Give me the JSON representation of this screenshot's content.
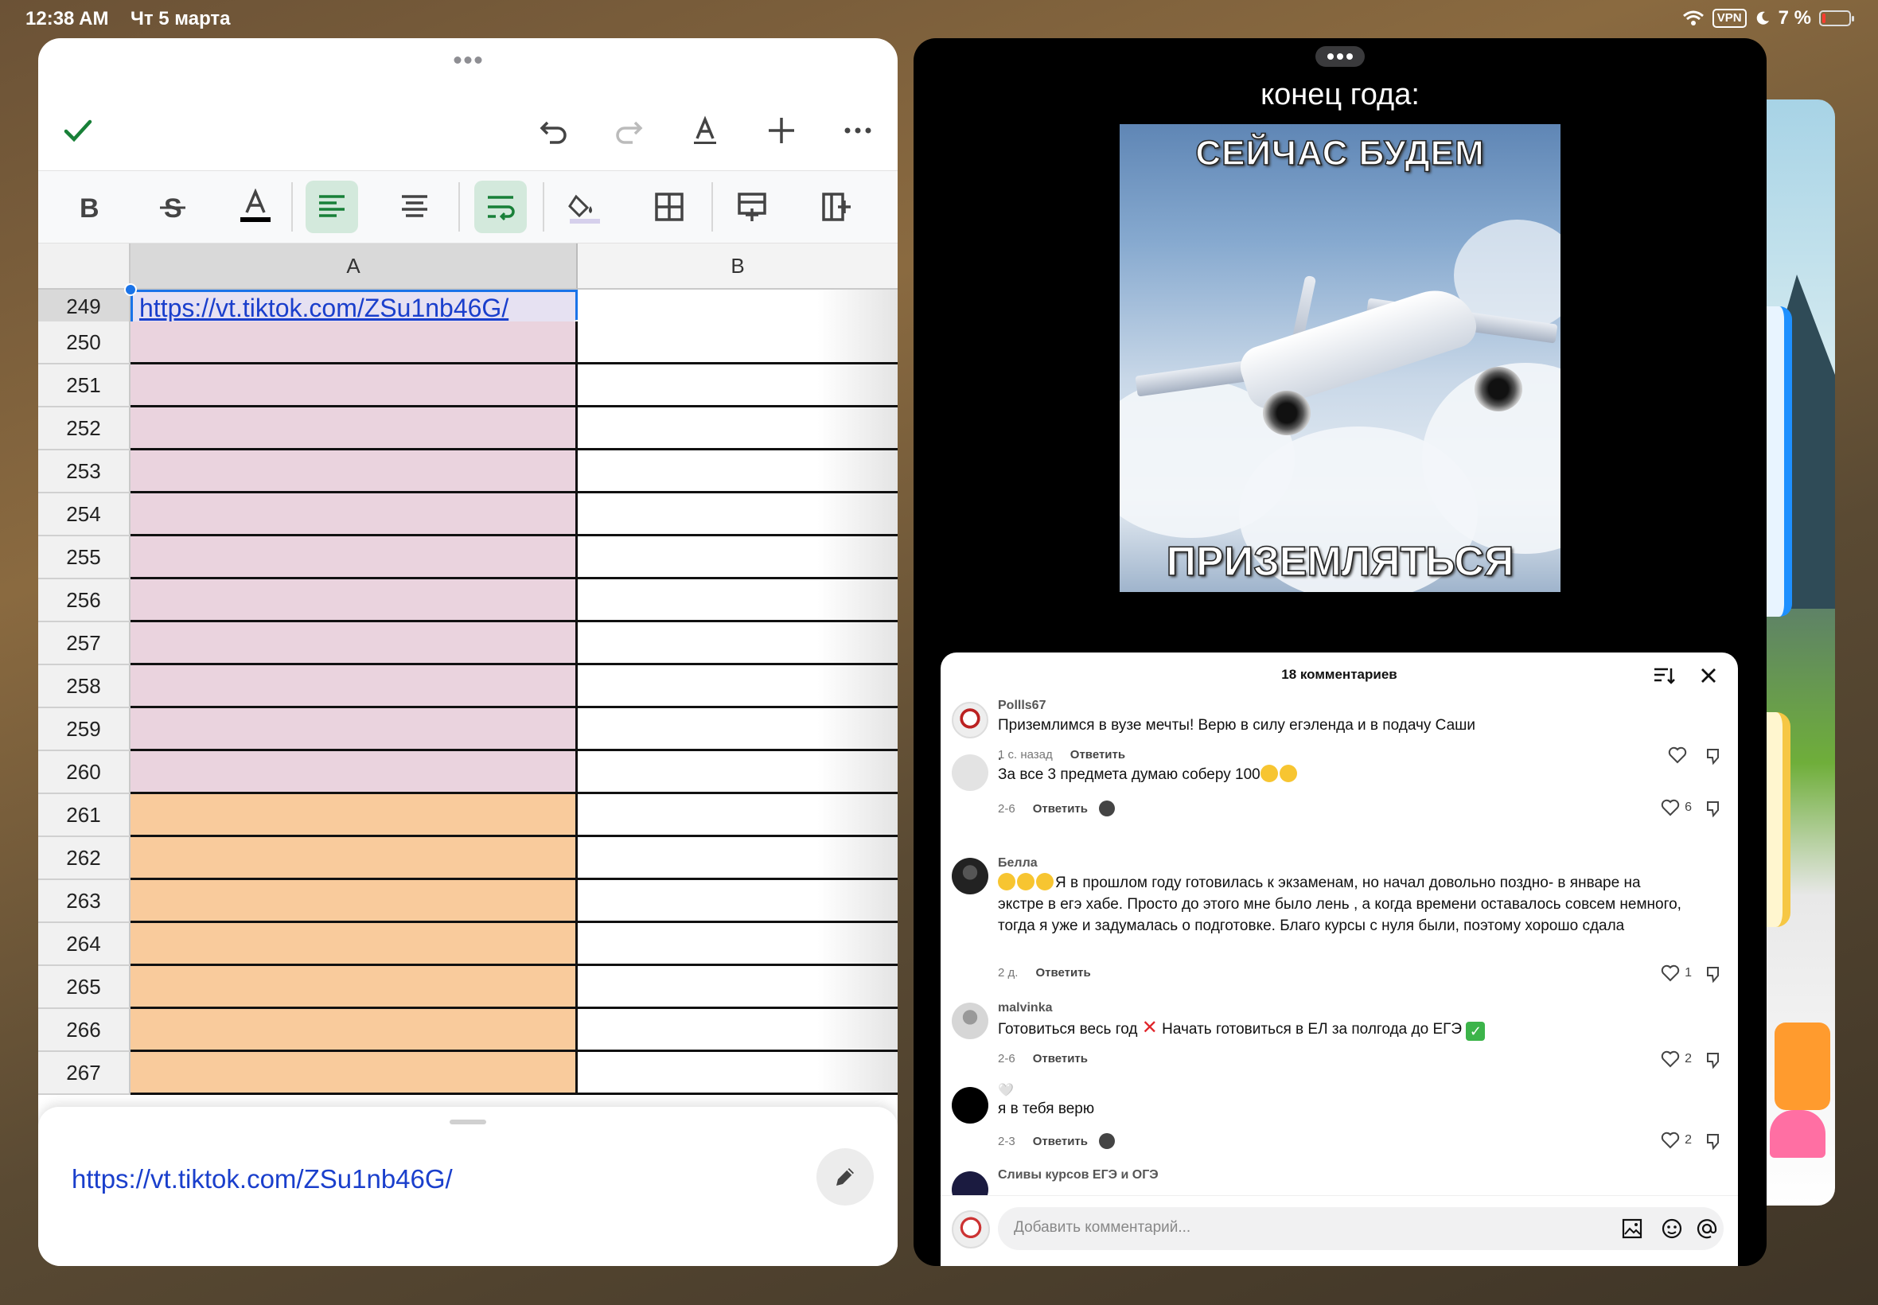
{
  "status_bar": {
    "time": "12:38 AM",
    "date": "Чт 5 марта",
    "vpn": "VPN",
    "battery": "7 %"
  },
  "spreadsheet": {
    "columns": [
      "A",
      "B"
    ],
    "rows": [
      {
        "num": "249",
        "a": "https://vt.tiktok.com/ZSu1nb46G/",
        "color": "#e6e1f2"
      },
      {
        "num": "250",
        "a": "",
        "color": "#ead3de"
      },
      {
        "num": "251",
        "a": "",
        "color": "#ead3de"
      },
      {
        "num": "252",
        "a": "",
        "color": "#ead3de"
      },
      {
        "num": "253",
        "a": "",
        "color": "#ead3de"
      },
      {
        "num": "254",
        "a": "",
        "color": "#ead3de"
      },
      {
        "num": "255",
        "a": "",
        "color": "#ead3de"
      },
      {
        "num": "256",
        "a": "",
        "color": "#ead3de"
      },
      {
        "num": "257",
        "a": "",
        "color": "#ead3de"
      },
      {
        "num": "258",
        "a": "",
        "color": "#ead3de"
      },
      {
        "num": "259",
        "a": "",
        "color": "#ead3de"
      },
      {
        "num": "260",
        "a": "",
        "color": "#ead3de"
      },
      {
        "num": "261",
        "a": "",
        "color": "#f9cb9c"
      },
      {
        "num": "262",
        "a": "",
        "color": "#f9cb9c"
      },
      {
        "num": "263",
        "a": "",
        "color": "#f9cb9c"
      },
      {
        "num": "264",
        "a": "",
        "color": "#f9cb9c"
      },
      {
        "num": "265",
        "a": "",
        "color": "#f9cb9c"
      },
      {
        "num": "266",
        "a": "",
        "color": "#f9cb9c"
      },
      {
        "num": "267",
        "a": "",
        "color": "#f9cb9c"
      }
    ],
    "edit_value": "https://vt.tiktok.com/ZSu1nb46G/",
    "accent": "#1a73e8"
  },
  "video": {
    "caption": "конец года:",
    "meme_top": "СЕЙЧАС БУДЕМ",
    "meme_bottom": "ПРИЗЕМЛЯТЬСЯ"
  },
  "comments": {
    "title": "18 комментариев",
    "placeholder": "Добавить комментарий...",
    "reply_label": "Ответить",
    "items": [
      {
        "name": "Pollls67",
        "text": "Приземлимся в вузе мечты! Верю в силу егэленда и в подачу Саши",
        "time": "1 с. назад",
        "likes": ""
      },
      {
        "name": ".",
        "text": "За все 3 предмета думаю соберу 100",
        "time": "2-6",
        "likes": "6"
      },
      {
        "name": "Белла",
        "text": "Я в прошлом году готовилась к экзаменам, но начал довольно поздно- в январе на экстре в егэ хабе. Просто до этого мне было лень , а когда времени оставалось совсем немного, тогда я уже и задумалась о подготовке. Благо курсы с нуля были, поэтому хорошо сдала",
        "time": "2 д.",
        "likes": "1"
      },
      {
        "name": "malvinka",
        "text_a": "Готовиться весь год",
        "text_b": "Начать готовиться в ЕЛ за полгода до ЕГЭ",
        "time": "2-6",
        "likes": "2"
      },
      {
        "name": "🤍",
        "text": "я в тебя верю",
        "time": "2-3",
        "likes": "2"
      },
      {
        "name": "Сливы курсов ЕГЭ и ОГЭ"
      }
    ]
  }
}
